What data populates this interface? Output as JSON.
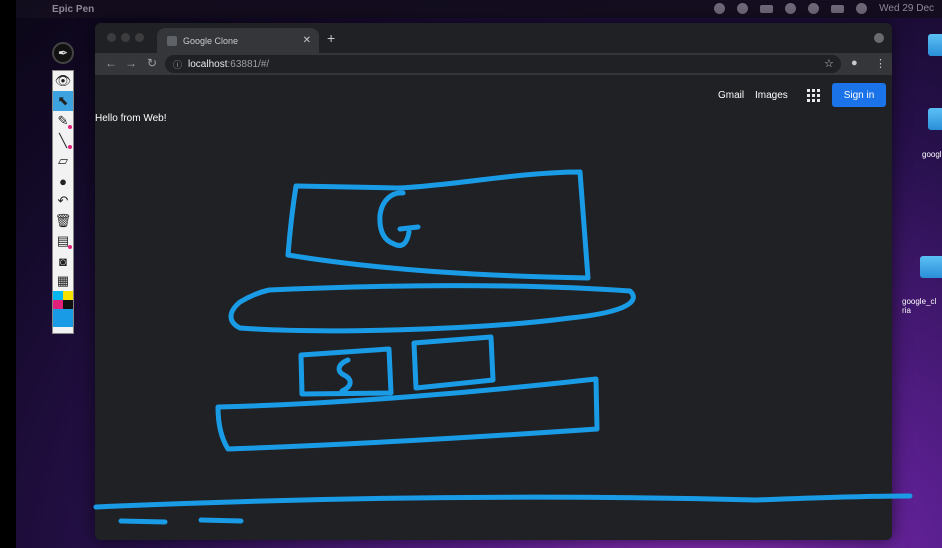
{
  "menubar": {
    "app_name": "Epic Pen",
    "clock": "Wed 29 Dec"
  },
  "epic_pen": {
    "tools": [
      "eye-icon",
      "cursor-icon",
      "pen-icon",
      "line-icon",
      "eraser-icon",
      "dot-icon",
      "undo-icon",
      "trash-icon",
      "board-icon",
      "camera-icon",
      "clipboard-icon"
    ],
    "palette": [
      "#00b7f0",
      "#f5e100",
      "#e0207a",
      "#111111"
    ],
    "current_color": "#1a9be6"
  },
  "desktop": {
    "items": [
      {
        "label": "googl"
      },
      {
        "label": "google_cl\nria"
      }
    ]
  },
  "browser": {
    "tab_title": "Google Clone",
    "url_host": "localhost",
    "url_rest": ":63881/#/"
  },
  "page": {
    "hello_text": "Hello from Web!",
    "nav_gmail": "Gmail",
    "nav_images": "Images",
    "signin_label": "Sign in",
    "accent": "#1a73e8"
  },
  "annotation": {
    "stroke_color": "#1a9be6",
    "letters": [
      "G",
      "S"
    ]
  }
}
